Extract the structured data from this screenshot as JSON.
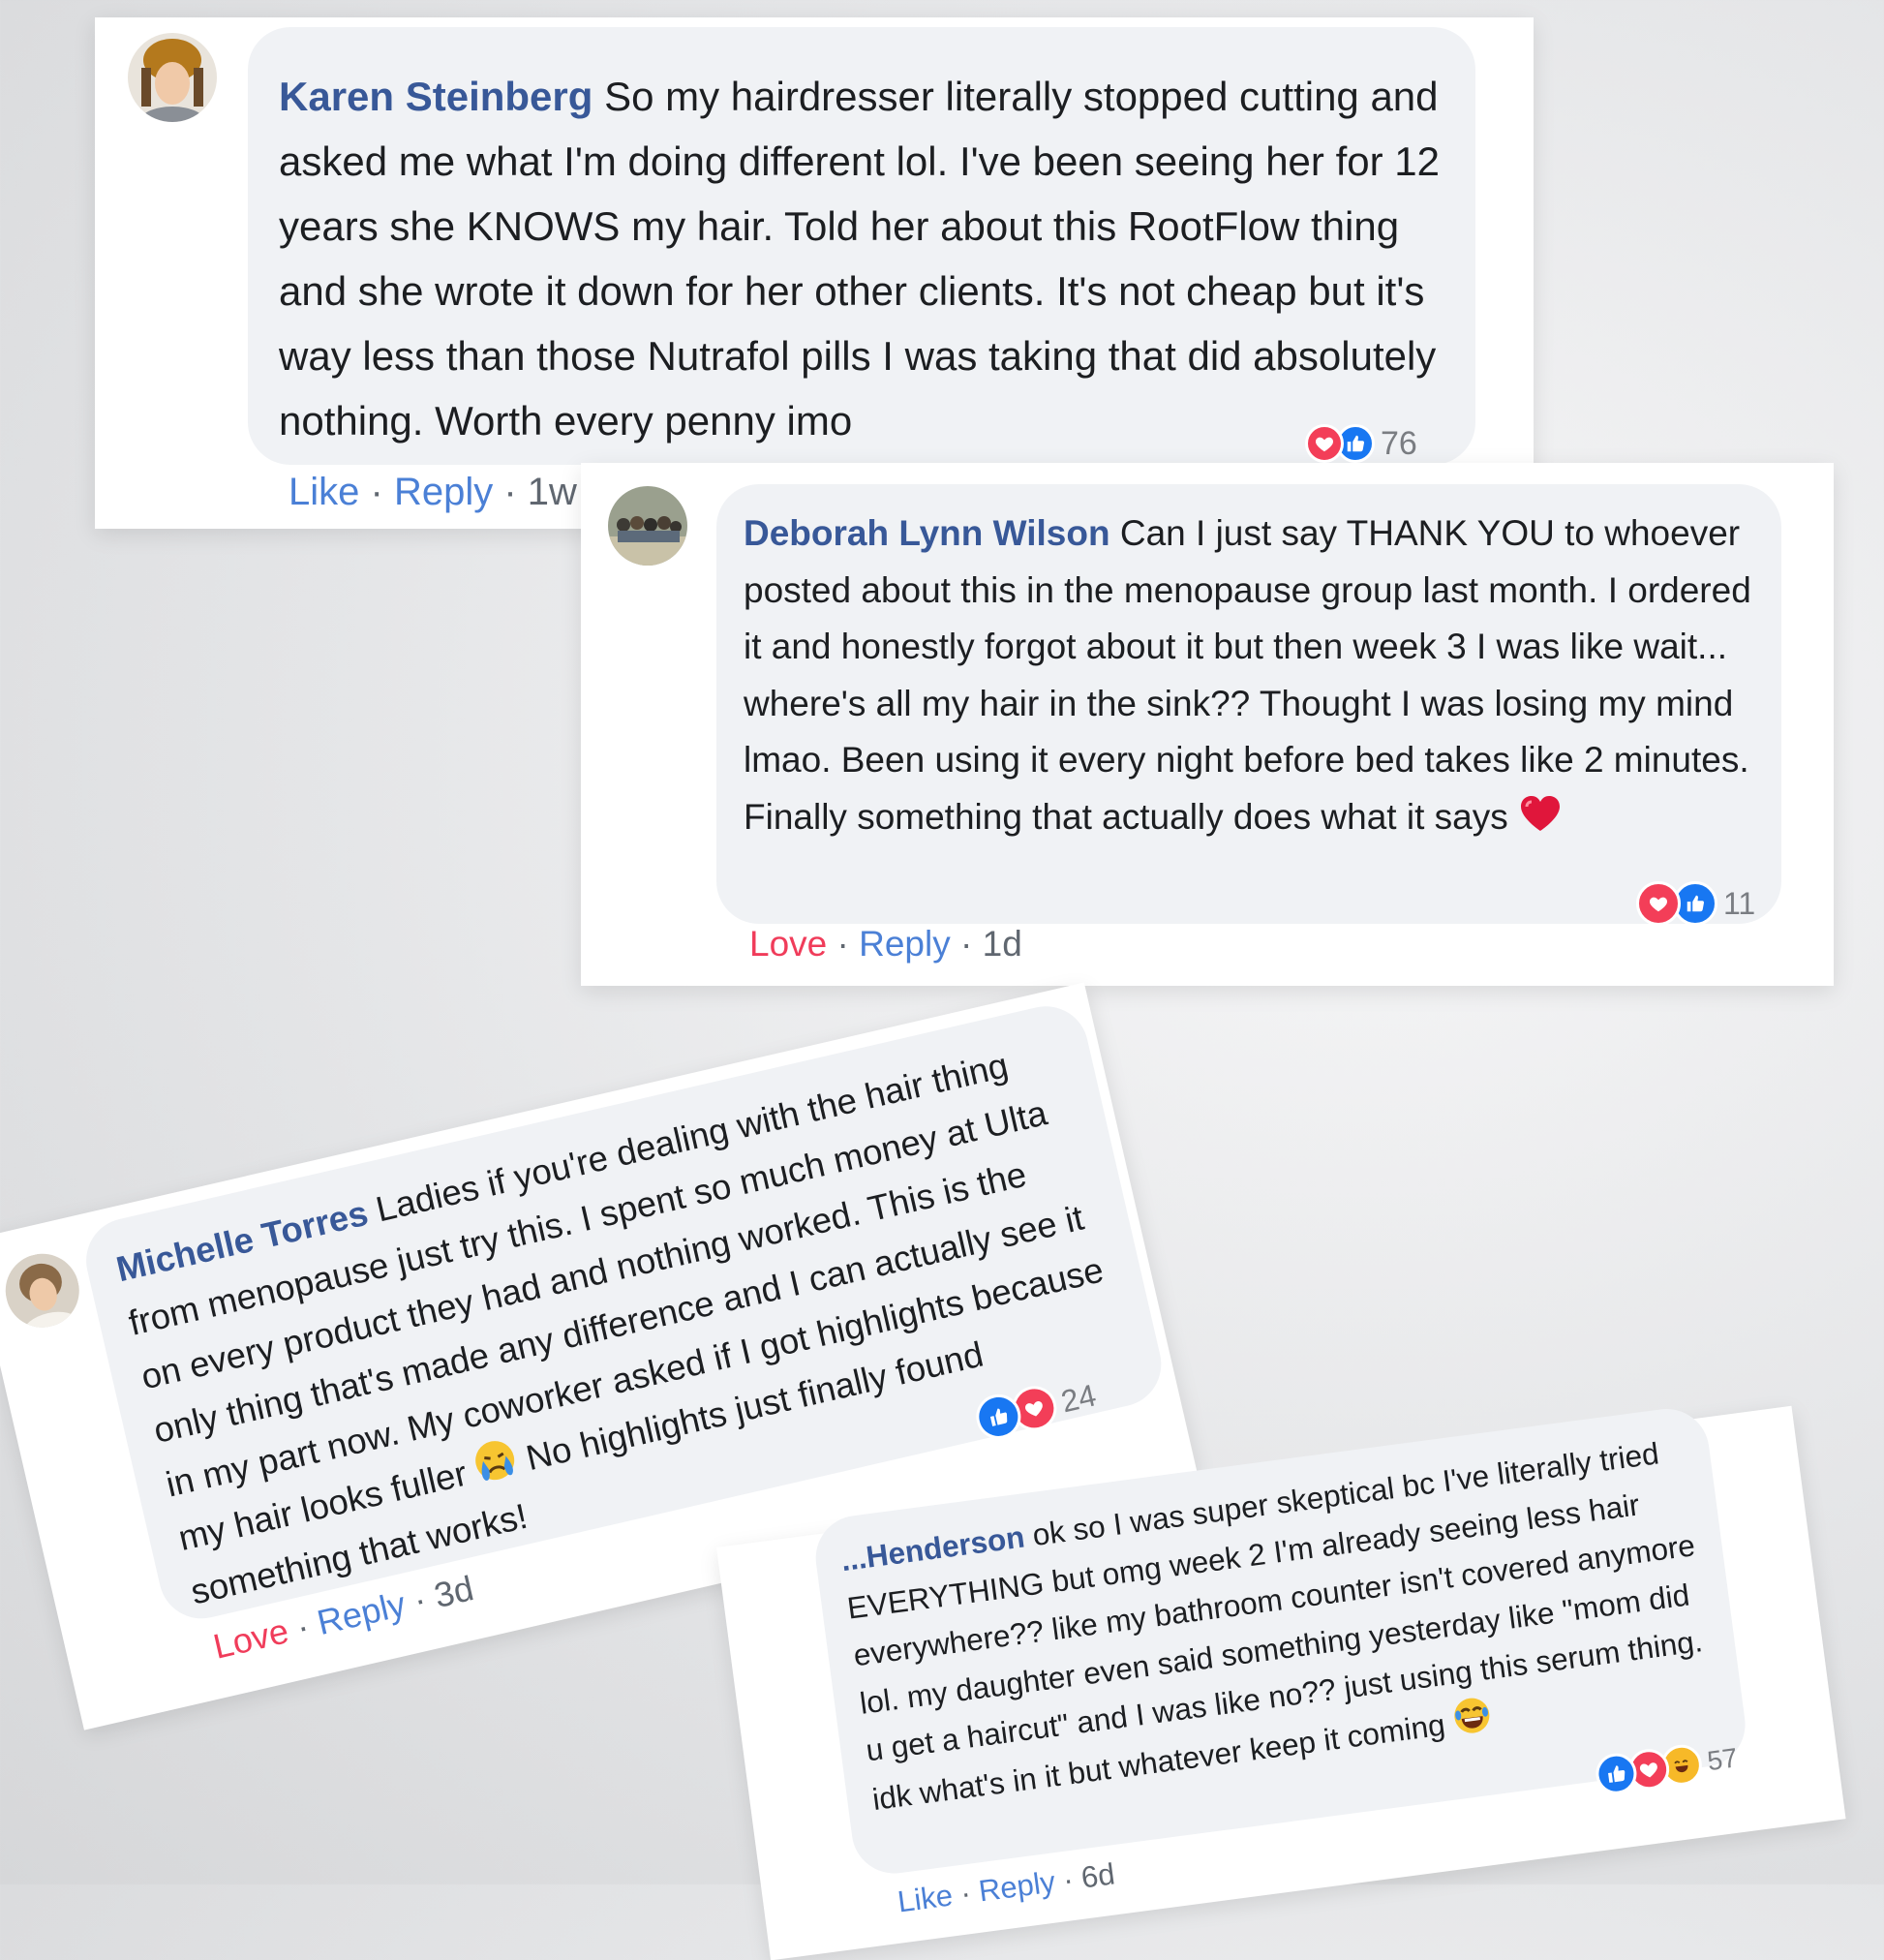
{
  "comments": [
    {
      "author": "Karen Steinberg",
      "text": "So my hairdresser literally stopped cutting and asked me what I'm doing different lol. I've been seeing her for 12 years she KNOWS my hair. Told her about this RootFlow thing and she wrote it down for her other clients. It's not cheap but it's way less than those Nutrafol pills I was taking that did absolutely nothing. Worth every penny imo",
      "action": "Like",
      "reply": "Reply",
      "time": "1w",
      "reaction_count": "76",
      "reactions": [
        "love-icon",
        "like-icon"
      ]
    },
    {
      "author": "Deborah Lynn Wilson",
      "text": "Can I just say THANK YOU to whoever posted about this in the menopause group last month. I ordered it and honestly forgot about it but then week 3 I was like wait... where's all my hair in the sink?? Thought I was losing my mind lmao. Been using it every night before bed takes like 2 minutes. Finally something that actually does what it says",
      "emoji": "heart-emoji",
      "action": "Love",
      "reply": "Reply",
      "time": "1d",
      "reaction_count": "11",
      "reactions": [
        "love-icon",
        "like-icon"
      ]
    },
    {
      "author": "Michelle Torres",
      "text": "Ladies if you're dealing with the hair thing from menopause just try this. I spent so much money at Ulta on every product they had and nothing worked. This is the only thing that's made any difference and I can actually see it in my part now. My coworker asked if I got highlights because my hair looks fuller",
      "emoji": "crying-emoji",
      "text_after": "No highlights just finally found something that works!",
      "action": "Love",
      "reply": "Reply",
      "time": "3d",
      "reaction_count": "24",
      "reactions": [
        "like-icon",
        "love-icon"
      ]
    },
    {
      "author": "...Henderson",
      "text": "ok so I was super skeptical bc I've literally tried EVERYTHING but omg week 2 I'm already seeing less hair everywhere?? like my bathroom counter isn't covered anymore lol. my daughter even said something yesterday like \"mom did u get a haircut\" and I was like no?? just using this serum thing. idk what's in it but whatever keep it coming",
      "emoji": "laughing-emoji",
      "action": "Like",
      "reply": "Reply",
      "time": "6d",
      "reaction_count": "57",
      "reactions": [
        "like-icon",
        "love-icon",
        "haha-icon"
      ]
    }
  ],
  "colors": {
    "name": "#385898",
    "like": "#1877f2",
    "love": "#f33e58",
    "bubble": "#f0f2f5",
    "action_link": "#4b80d6",
    "action_love": "#f03c5a"
  }
}
